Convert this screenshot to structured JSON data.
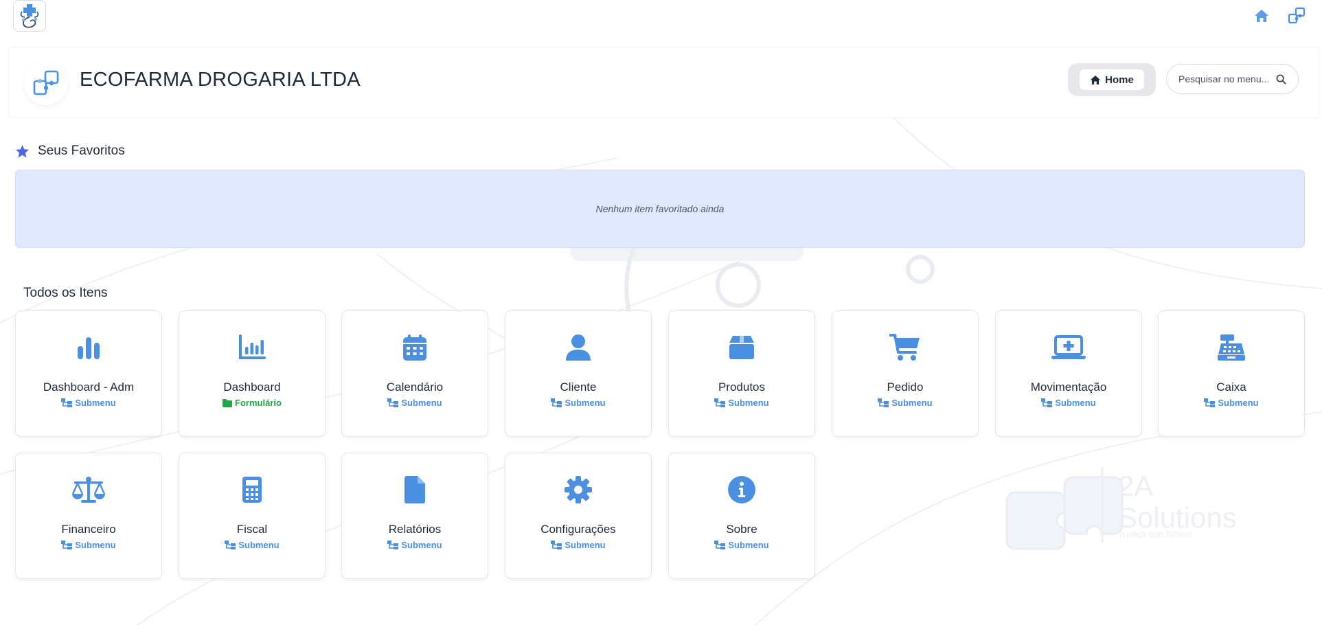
{
  "top_bar": {
    "logo_icon": "pharmacy-logo-icon",
    "home_icon": "home-icon",
    "modules_icon": "puzzle-icon"
  },
  "header": {
    "company_icon": "puzzle-icon",
    "company_name": "ECOFARMA DROGARIA LTDA",
    "home_label": "Home",
    "search_placeholder": "Pesquisar no menu..."
  },
  "favorites": {
    "title": "Seus Favoritos",
    "empty_text": "Nenhum item favoritado ainda"
  },
  "all_items": {
    "title": "Todos os Itens",
    "items": [
      {
        "title": "Dashboard - Adm",
        "type": "Submenu",
        "icon": "chart-bars-icon"
      },
      {
        "title": "Dashboard",
        "type": "Formulário",
        "icon": "chart-column-icon"
      },
      {
        "title": "Calendário",
        "type": "Submenu",
        "icon": "calendar-icon"
      },
      {
        "title": "Cliente",
        "type": "Submenu",
        "icon": "user-icon"
      },
      {
        "title": "Produtos",
        "type": "Submenu",
        "icon": "box-icon"
      },
      {
        "title": "Pedido",
        "type": "Submenu",
        "icon": "cart-icon"
      },
      {
        "title": "Movimentação",
        "type": "Submenu",
        "icon": "laptop-medical-icon"
      },
      {
        "title": "Caixa",
        "type": "Submenu",
        "icon": "cash-register-icon"
      },
      {
        "title": "Financeiro",
        "type": "Submenu",
        "icon": "scale-icon"
      },
      {
        "title": "Fiscal",
        "type": "Submenu",
        "icon": "calculator-icon"
      },
      {
        "title": "Relatórios",
        "type": "Submenu",
        "icon": "file-icon"
      },
      {
        "title": "Configurações",
        "type": "Submenu",
        "icon": "gear-icon"
      },
      {
        "title": "Sobre",
        "type": "Submenu",
        "icon": "info-icon"
      }
    ]
  },
  "watermark": {
    "brand": "2A",
    "brand_sub": "Solutions",
    "tagline": "a peça que faltava"
  },
  "colors": {
    "accent": "#4a8fe0",
    "favorites_bg": "#e1e7fe",
    "star": "#4f63e6",
    "form_green": "#22a447"
  }
}
